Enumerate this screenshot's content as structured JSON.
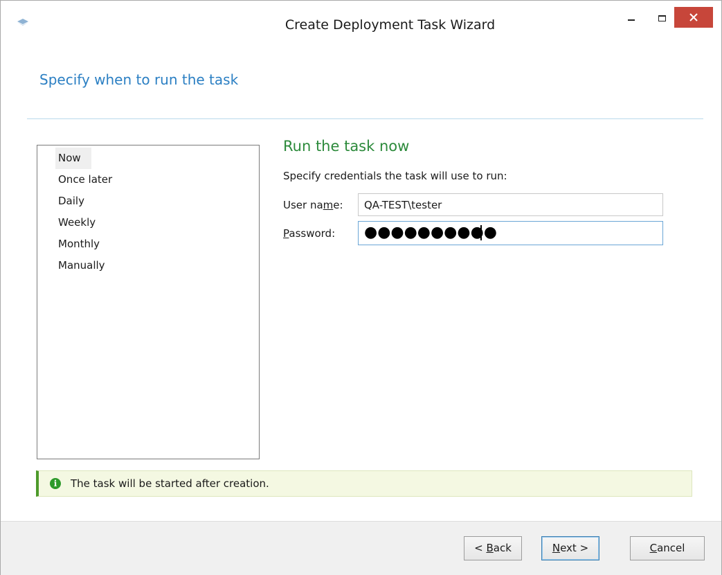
{
  "window": {
    "title": "Create Deployment Task Wizard"
  },
  "header": {
    "title": "Specify when to run the task"
  },
  "schedule": {
    "items": [
      {
        "label": "Now",
        "selected": true
      },
      {
        "label": "Once later",
        "selected": false
      },
      {
        "label": "Daily",
        "selected": false
      },
      {
        "label": "Weekly",
        "selected": false
      },
      {
        "label": "Monthly",
        "selected": false
      },
      {
        "label": "Manually",
        "selected": false
      }
    ]
  },
  "run": {
    "heading": "Run the task now",
    "credentials_prompt": "Specify credentials the task will use to run:",
    "username_label_pre": "User na",
    "username_label_accel": "m",
    "username_label_post": "e:",
    "username_value": "QA-TEST\\tester",
    "password_label_accel": "P",
    "password_label_post": "assword:",
    "password_mask": "●●●●●●●●●●"
  },
  "info": {
    "message": "The task will be started after creation.",
    "icon": "info-icon"
  },
  "buttons": {
    "back_pre": "< ",
    "back_accel": "B",
    "back_post": "ack",
    "next_accel": "N",
    "next_post": "ext >",
    "cancel_accel": "C",
    "cancel_post": "ancel"
  },
  "colors": {
    "title_blue": "#2b7fc3",
    "heading_green": "#2c8a3b",
    "close_red": "#c7463a",
    "info_bg": "#f4f8e2",
    "info_accent": "#4d9a2a"
  }
}
